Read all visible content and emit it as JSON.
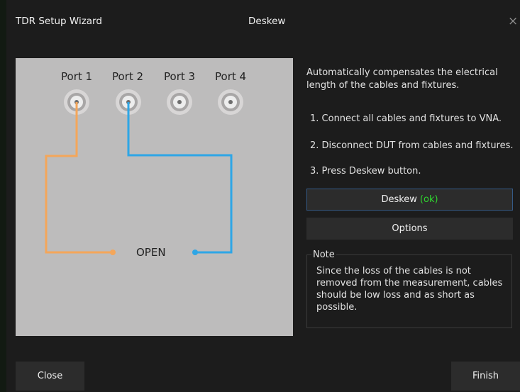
{
  "window": {
    "title": "TDR Setup Wizard",
    "step": "Deskew",
    "close_glyph": "×"
  },
  "diagram": {
    "ports": [
      "Port 1",
      "Port 2",
      "Port 3",
      "Port 4"
    ],
    "open_label": "OPEN",
    "colors": {
      "port1_cable": "#f4a65a",
      "port2_cable": "#2ea6e6"
    }
  },
  "panel": {
    "description": "Automatically compensates the electrical length of the cables and fixtures.",
    "steps": [
      "1. Connect all cables and fixtures to VNA.",
      "2. Disconnect DUT from cables and fixtures.",
      "3. Press Deskew button."
    ],
    "deskew_label": "Deskew",
    "deskew_status": "(ok)",
    "options_label": "Options",
    "note_title": "Note",
    "note_text": "Since the loss of the cables is not removed from the measurement, cables should be low loss and as short as possible."
  },
  "footer": {
    "close_label": "Close",
    "finish_label": "Finish"
  }
}
